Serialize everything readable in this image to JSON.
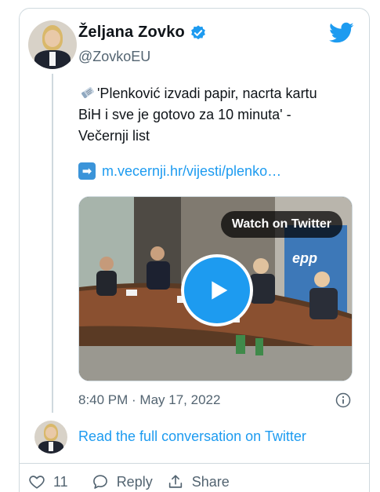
{
  "author": {
    "name": "Željana Zovko",
    "handle": "@ZovkoEU",
    "verified": true
  },
  "tweet": {
    "emoji_icon": "newspaper-icon",
    "text": "'Plenković izvadi papir, nacrta kartu BiH i sve je gotovo za 10 minuta' - Večernji list",
    "link_icon": "right-arrow-icon",
    "link_text": "m.vecernji.hr/vijesti/plenko…"
  },
  "media": {
    "watch_label": "Watch on Twitter",
    "logo_text": "epp"
  },
  "timestamp": "8:40 PM · May 17, 2022",
  "read_more": "Read the full conversation on Twitter",
  "actions": {
    "like_count": "11",
    "reply_label": "Reply",
    "share_label": "Share"
  },
  "colors": {
    "accent": "#1d9bf0",
    "secondary_text": "#536471",
    "border": "#cfd9de"
  }
}
